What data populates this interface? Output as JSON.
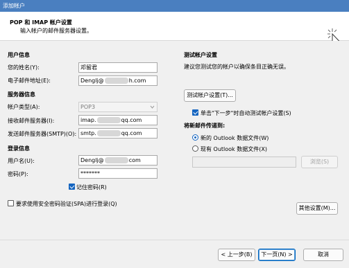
{
  "window": {
    "title": "添加帐户"
  },
  "header": {
    "title": "POP 和 IMAP 帐户设置",
    "subtitle": "输入帐户的邮件服务器设置。",
    "icon": "cursor-click-icon"
  },
  "user_info": {
    "section_label": "用户信息",
    "name_label": "您的姓名(Y):",
    "name_value": "邓留君",
    "email_label": "电子邮件地址(E):",
    "email_prefix": "Denglj@",
    "email_suffix": "h.com"
  },
  "server_info": {
    "section_label": "服务器信息",
    "account_type_label": "帐户类型(A):",
    "account_type_value": "POP3",
    "incoming_label": "接收邮件服务器(I):",
    "incoming_prefix": "imap.",
    "incoming_suffix": "qq.com",
    "outgoing_label": "发送邮件服务器(SMTP)(O):",
    "outgoing_prefix": "smtp.",
    "outgoing_suffix": "qq.com"
  },
  "logon_info": {
    "section_label": "登录信息",
    "username_label": "用户名(U):",
    "username_prefix": "Denglj@",
    "username_suffix": "com",
    "password_label": "密码(P):",
    "password_value": "*******",
    "remember_label": "记住密码(R)",
    "remember_checked": true,
    "spa_label": "要求使用安全密码验证(SPA)进行登录(Q)",
    "spa_checked": false
  },
  "test": {
    "section_label": "测试帐户设置",
    "description": "建议您测试您的帐户以确保条目正确无误。",
    "test_button": "测试帐户设置(T)...",
    "auto_test_label": "单击\"下一步\"时自动测试帐户设置(S)",
    "auto_test_checked": true
  },
  "deliver": {
    "section_label": "将新邮件传递到:",
    "new_file_label": "新的 Outlook 数据文件(W)",
    "existing_file_label": "现有 Outlook 数据文件(X)",
    "selected": "new",
    "browse_button": "浏览(S)"
  },
  "more_settings_button": "其他设置(M)...",
  "footer": {
    "back_button": "< 上一步(B)",
    "next_button": "下一页(N) >",
    "cancel_button": "取消"
  },
  "colors": {
    "titlebar": "#4a7fc0",
    "accent": "#1565c0"
  }
}
